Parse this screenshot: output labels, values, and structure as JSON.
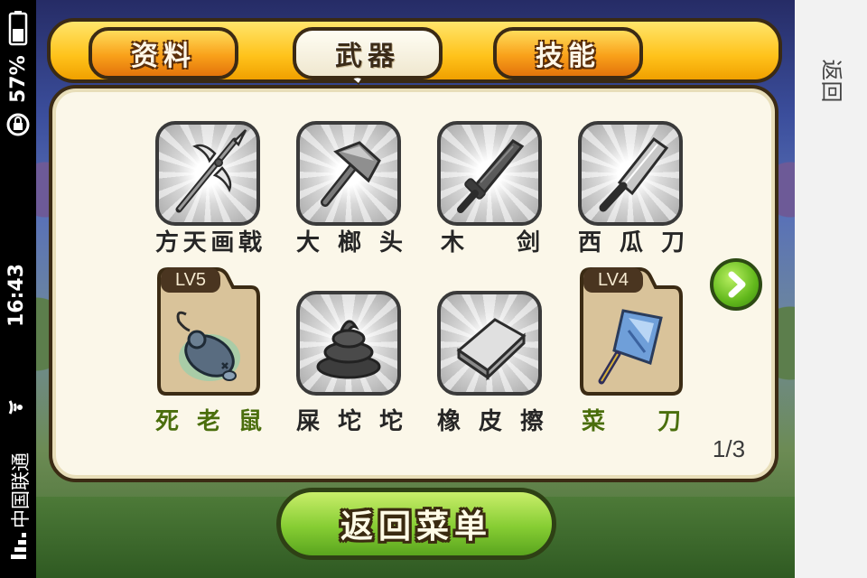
{
  "status_bar": {
    "carrier": "中国联通",
    "time": "16:43",
    "battery": "57%",
    "wifi_icon": "wifi-icon",
    "signal_icon": "signal-icon",
    "rotation_lock_icon": "rotation-lock-icon",
    "battery_icon": "battery-icon"
  },
  "side_panel": {
    "back_label": "返回"
  },
  "tabs": [
    {
      "label": "资料",
      "active": false
    },
    {
      "label": "武器",
      "active": true
    },
    {
      "label": "技能",
      "active": false
    }
  ],
  "items": [
    {
      "name_chars": [
        "方",
        "天",
        "画",
        "戟"
      ],
      "owned": false,
      "level": "",
      "icon": "halberd-icon"
    },
    {
      "name_chars": [
        "大",
        "榔",
        "头"
      ],
      "owned": false,
      "level": "",
      "icon": "hammer-icon"
    },
    {
      "name_chars": [
        "木",
        "剑"
      ],
      "owned": false,
      "level": "",
      "icon": "wooden-sword-icon"
    },
    {
      "name_chars": [
        "西",
        "瓜",
        "刀"
      ],
      "owned": false,
      "level": "",
      "icon": "machete-icon"
    },
    {
      "name_chars": [
        "死",
        "老",
        "鼠"
      ],
      "owned": true,
      "level": "LV5",
      "icon": "dead-mouse-icon"
    },
    {
      "name_chars": [
        "屎",
        "坨",
        "坨"
      ],
      "owned": false,
      "level": "",
      "icon": "poop-icon"
    },
    {
      "name_chars": [
        "橡",
        "皮",
        "擦"
      ],
      "owned": false,
      "level": "",
      "icon": "eraser-icon"
    },
    {
      "name_chars": [
        "菜",
        "刀"
      ],
      "owned": true,
      "level": "LV4",
      "icon": "cleaver-icon"
    }
  ],
  "pagination": {
    "indicator": "1/3",
    "next_icon": "chevron-right-icon"
  },
  "menu_button": {
    "label": "返回菜单"
  },
  "colors": {
    "tab_orange": "#f9a11a",
    "owned_text": "#4a6e0c",
    "button_green": "#86cd33",
    "panel_bg": "#fbf7e9"
  }
}
